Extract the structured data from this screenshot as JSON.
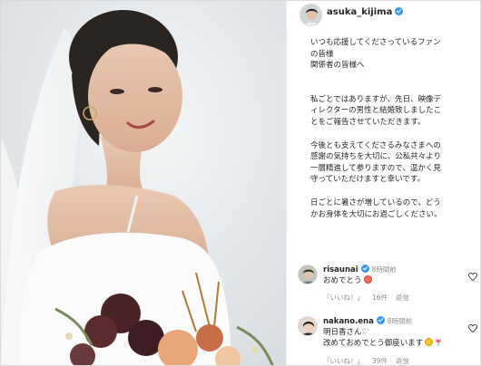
{
  "post": {
    "username": "asuka_kijima",
    "verified": true,
    "caption_lines": [
      "いつも応援してくださっているファン",
      "の皆様",
      "関係者の皆様へ",
      "私ごとではありますが、先日、映像デ",
      "ィレクターの男性と結婚致しましたこ",
      "とをご報告させていただきます。",
      "今後とも支えてくださるみなさまへの",
      "感謝の気持ちを大切に、公私共々より",
      "一層精進して参りますので、温かく見",
      "守っていただけますと幸いです。",
      "日ごとに暑さが増しているので、どう",
      "かお身体を大切にお過ごしください。"
    ]
  },
  "comments": [
    {
      "username": "risaunai",
      "time": "8時間前",
      "lines": [
        "おめでとう"
      ],
      "emojis": [
        "heart-eyes-emoji"
      ],
      "like_label": "「いいね！」",
      "likes": "16件",
      "reply_label": "返信"
    },
    {
      "username": "nakano.ena",
      "time": "8時間前",
      "lines": [
        "明日香さん♡",
        "改めておめでとう御座います"
      ],
      "emojis": [
        "smiling-face-emoji",
        "tulip-emoji"
      ],
      "like_label": "「いいね！」",
      "likes": "39件",
      "reply_label": "返信"
    }
  ],
  "colors": {
    "verified_blue": "#3897f0",
    "meta_gray": "#8e8e8e",
    "border": "#dbdbdb"
  }
}
